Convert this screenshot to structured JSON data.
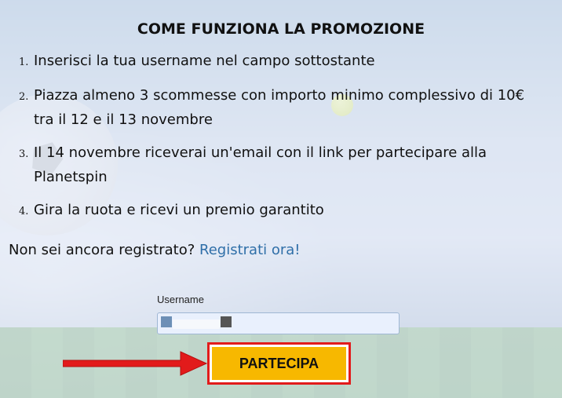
{
  "promo": {
    "title": "COME FUNZIONA LA PROMOZIONE",
    "steps": [
      {
        "num": "1.",
        "text": "Inserisci la tua username nel campo sottostante"
      },
      {
        "num": "2.",
        "text": "Piazza almeno 3 scommesse con importo minimo complessivo di 10€ tra il 12 e il 13 novembre"
      },
      {
        "num": "3.",
        "text": "Il 14 novembre riceverai un'email con il link per partecipare alla Planetspin"
      },
      {
        "num": "4.",
        "text": "Gira la ruota e ricevi un premio garantito"
      }
    ],
    "register_prompt": "Non sei ancora registrato?",
    "register_link": "Registrati ora!"
  },
  "form": {
    "username_label": "Username",
    "username_value": "",
    "submit_label": "PARTECIPA"
  },
  "colors": {
    "link": "#2f6fa8",
    "button": "#f7b800",
    "highlight": "#e21b1b"
  },
  "icons": {
    "annotation": "red-arrow-icon"
  }
}
